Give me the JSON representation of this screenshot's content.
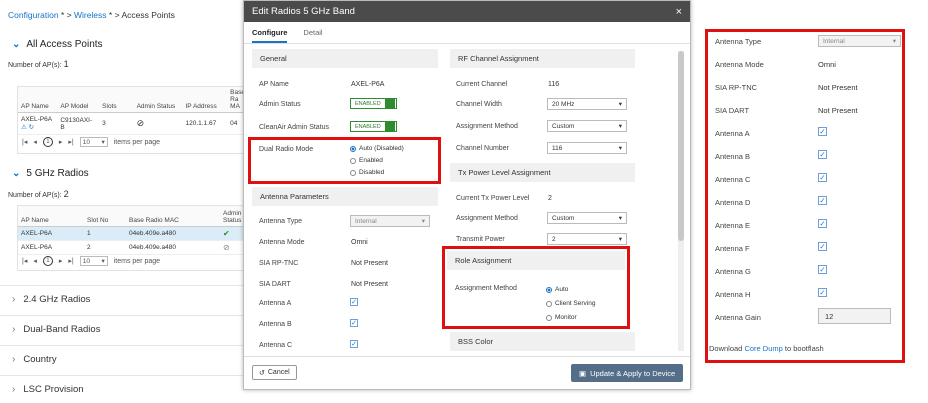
{
  "breadcrumb": {
    "item1": "Configuration",
    "sep1": "*  >",
    "item2": "Wireless",
    "sep2": "*  >",
    "item3": "Access Points"
  },
  "all_aps": {
    "title": "All Access Points",
    "count_label": "Number of AP(s):",
    "count": "1",
    "headers": [
      "AP Name",
      "AP Model",
      "Slots",
      "Admin Status",
      "IP Address",
      "Base Ra MA"
    ],
    "row": {
      "name": "AXEL-P6A",
      "model": "C9130AXI-B",
      "slots": "3",
      "admin_icon": "disabled-icon",
      "ip": "120.1.1.67",
      "base": "04"
    },
    "pager": {
      "page": "1",
      "per_page": "10",
      "per_page_label": "items per page"
    }
  },
  "ghz5": {
    "title": "5 GHz Radios",
    "count_label": "Number of AP(s):",
    "count": "2",
    "headers": [
      "AP Name",
      "Slot No",
      "Base Radio MAC",
      "Admin Status"
    ],
    "rows": [
      {
        "name": "AXEL-P6A",
        "slot": "1",
        "mac": "04eb.409e.a480"
      },
      {
        "name": "AXEL-P6A",
        "slot": "2",
        "mac": "04eb.409e.a480"
      }
    ],
    "pager": {
      "page": "1",
      "per_page": "10",
      "per_page_label": "items per page"
    }
  },
  "collapsed_sections": [
    "2.4 GHz Radios",
    "Dual-Band Radios",
    "Country",
    "LSC Provision"
  ],
  "modal": {
    "title": "Edit Radios 5 GHz Band",
    "close": "×",
    "tabs": [
      "Configure",
      "Detail"
    ],
    "general": {
      "title": "General",
      "ap_name_label": "AP Name",
      "ap_name": "AXEL-P6A",
      "admin_label": "Admin Status",
      "admin_value": "ENABLED",
      "cleanair_label": "CleanAir Admin Status",
      "cleanair_value": "ENABLED"
    },
    "dual_radio": {
      "label": "Dual Radio Mode",
      "options": [
        "Auto (Disabled)",
        "Enabled",
        "Disabled"
      ],
      "selected": "Auto (Disabled)"
    },
    "antenna": {
      "title": "Antenna Parameters",
      "type_label": "Antenna Type",
      "type_value": "Internal",
      "mode_label": "Antenna Mode",
      "mode_value": "Omni",
      "siarp_label": "SIA RP-TNC",
      "siarp_value": "Not Present",
      "siadart_label": "SIA DART",
      "siadart_value": "Not Present",
      "a_label": "Antenna A",
      "b_label": "Antenna B",
      "c_label": "Antenna C"
    },
    "rf": {
      "title": "RF Channel Assignment",
      "current_label": "Current Channel",
      "current_value": "116",
      "width_label": "Channel Width",
      "width_value": "20 MHz",
      "method_label": "Assignment Method",
      "method_value": "Custom",
      "number_label": "Channel Number",
      "number_value": "116"
    },
    "tx": {
      "title": "Tx Power Level Assignment",
      "current_label": "Current Tx Power Level",
      "current_value": "2",
      "method_label": "Assignment Method",
      "method_value": "Custom",
      "transmit_label": "Transmit Power",
      "transmit_value": "2"
    },
    "role": {
      "title": "Role Assignment",
      "method_label": "Assignment Method",
      "options": [
        "Auto",
        "Client Serving",
        "Monitor"
      ],
      "selected": "Auto"
    },
    "bss": {
      "title": "BSS Color"
    },
    "cancel_label": "Cancel",
    "apply_label": "Update & Apply to Device"
  },
  "right_panel": {
    "type_label": "Antenna Type",
    "type_value": "Internal",
    "mode_label": "Antenna Mode",
    "mode_value": "Omni",
    "siarp_label": "SIA RP-TNC",
    "siarp_value": "Not Present",
    "siadart_label": "SIA DART",
    "siadart_value": "Not Present",
    "antennas": [
      "Antenna A",
      "Antenna B",
      "Antenna C",
      "Antenna D",
      "Antenna E",
      "Antenna F",
      "Antenna G",
      "Antenna H"
    ],
    "gain_label": "Antenna Gain",
    "gain_value": "12",
    "download_pre": "Download",
    "download_link": "Core Dump",
    "download_post": "to bootflash"
  },
  "colors": {
    "accent": "#1a73c7",
    "highlight": "#e01010",
    "enabled": "#2e8b2e",
    "header": "#4b4b4b"
  }
}
